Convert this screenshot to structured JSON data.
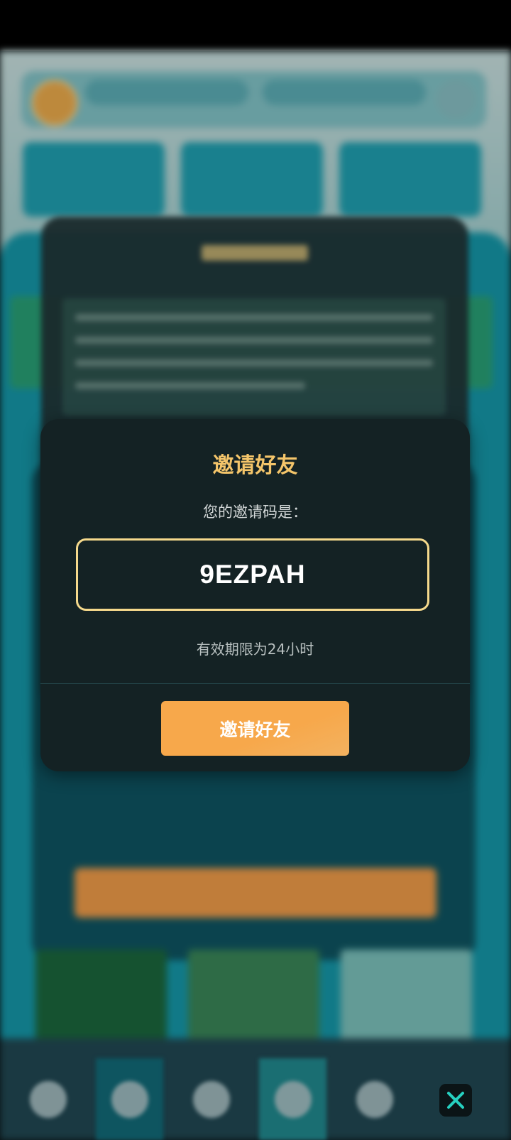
{
  "dialog": {
    "title": "邀请好友",
    "label": "您的邀请码是：",
    "code": "9EZPAH",
    "validity": "有效期限为24小时",
    "button_label": "邀请好友"
  },
  "colors": {
    "title": "#f4c56a",
    "code_border": "#f5d98c",
    "button": "#f7a84b",
    "dialog_bg": "#142224"
  },
  "icons": {
    "close": "close-icon"
  }
}
